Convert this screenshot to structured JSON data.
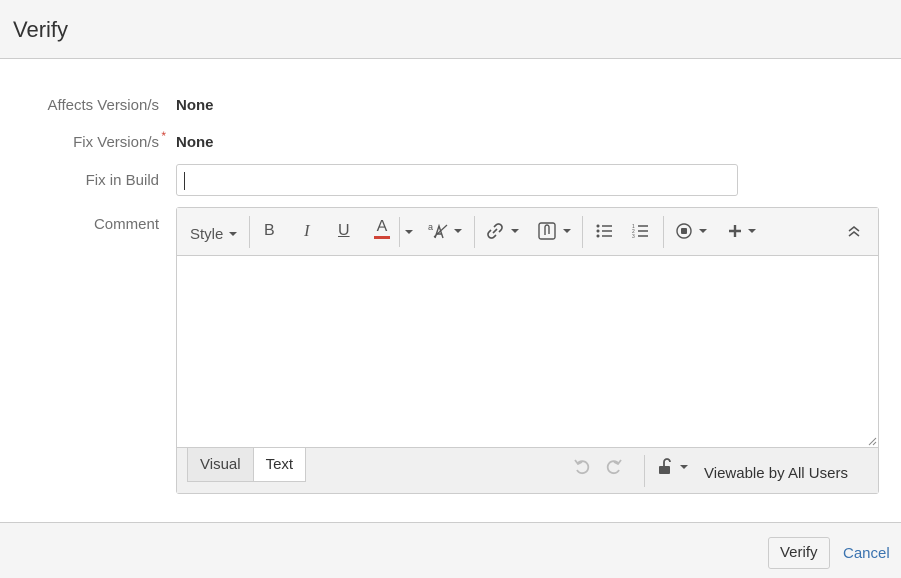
{
  "dialog": {
    "title": "Verify"
  },
  "fields": {
    "affects_label": "Affects Version/s",
    "affects_value": "None",
    "fix_label": "Fix Version/s",
    "fix_required": "*",
    "fix_value": "None",
    "build_label": "Fix in Build",
    "build_value": "",
    "comment_label": "Comment"
  },
  "toolbar": {
    "style_label": "Style",
    "bold_label": "B",
    "italic_label": "I",
    "underline_label": "U",
    "color_label": "A",
    "text_color": "#d04437"
  },
  "editor": {
    "content": "",
    "tabs": [
      {
        "label": "Visual"
      },
      {
        "label": "Text"
      }
    ],
    "active_tab": "Text",
    "visibility": "Viewable by All Users"
  },
  "footer": {
    "submit_label": "Verify",
    "cancel_label": "Cancel"
  },
  "colors": {
    "link": "#3b73af",
    "required": "#d04437"
  }
}
